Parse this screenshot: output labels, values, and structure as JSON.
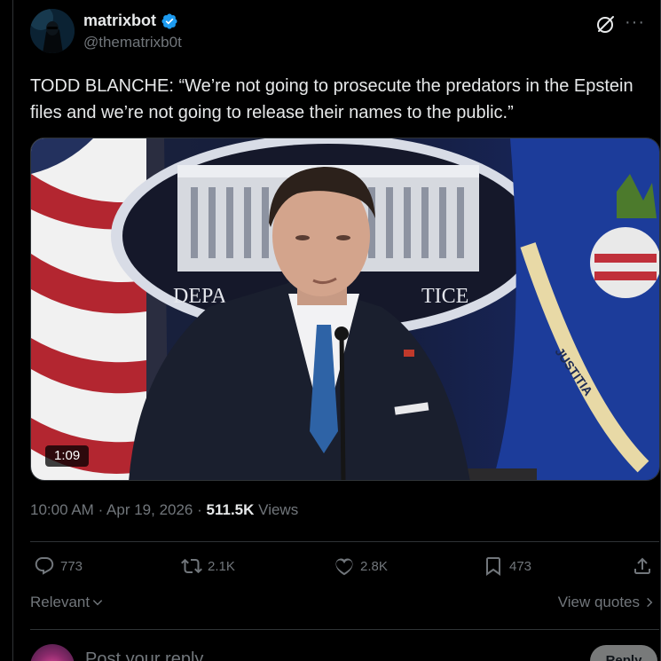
{
  "author": {
    "display_name": "matrixbot",
    "handle": "@thematrixb0t",
    "verified": true
  },
  "tweet": {
    "text": "TODD BLANCHE: “We’re not going to prosecute the predators in the Epstein files and we’re not going to release their names to the public.”"
  },
  "media": {
    "duration": "1:09",
    "description_icon": "video-thumbnail"
  },
  "meta": {
    "time": "10:00 AM",
    "date": "Apr 19, 2026",
    "views_count": "511.5K",
    "views_label": "Views",
    "separator": "·"
  },
  "actions": {
    "replies": "773",
    "reposts": "2.1K",
    "likes": "2.8K",
    "bookmarks": "473"
  },
  "replies_bar": {
    "sort_label": "Relevant",
    "view_quotes_label": "View quotes"
  },
  "composer": {
    "placeholder": "Post your reply",
    "reply_label": "Reply"
  },
  "colors": {
    "background": "#000000",
    "text": "#e7e9ea",
    "muted": "#71767b",
    "border": "#2f3336",
    "verified": "#1d9bf0"
  }
}
